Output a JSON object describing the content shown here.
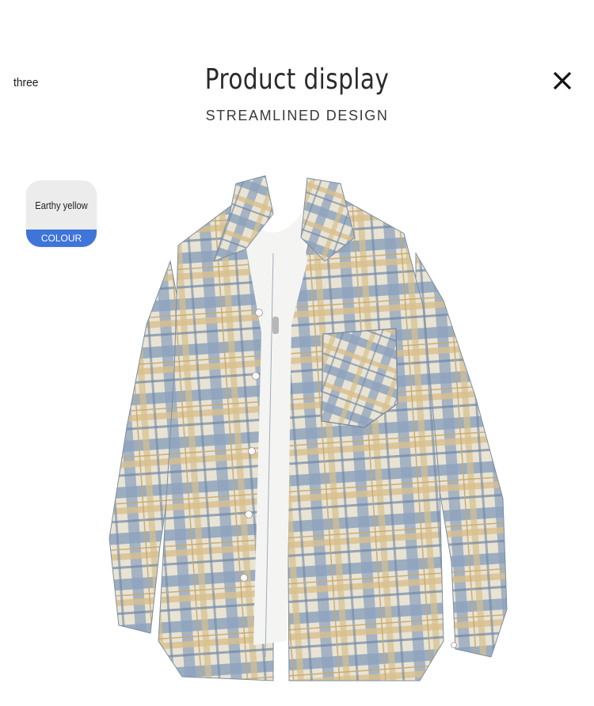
{
  "header": {
    "step_label": "three",
    "title": "Product display",
    "subtitle": "STREAMLINED DESIGN"
  },
  "close_icon": "close-icon",
  "color_swatch": {
    "name": "Earthy yellow",
    "label": "COLOUR",
    "accent_color": "#3f74d8"
  },
  "product": {
    "image_icon": "plaid-shirt-image",
    "colors": {
      "blue": "#7f97b5",
      "yellow": "#d9c08a",
      "cream": "#ece6d6",
      "tee": "#f4f4f2"
    }
  }
}
